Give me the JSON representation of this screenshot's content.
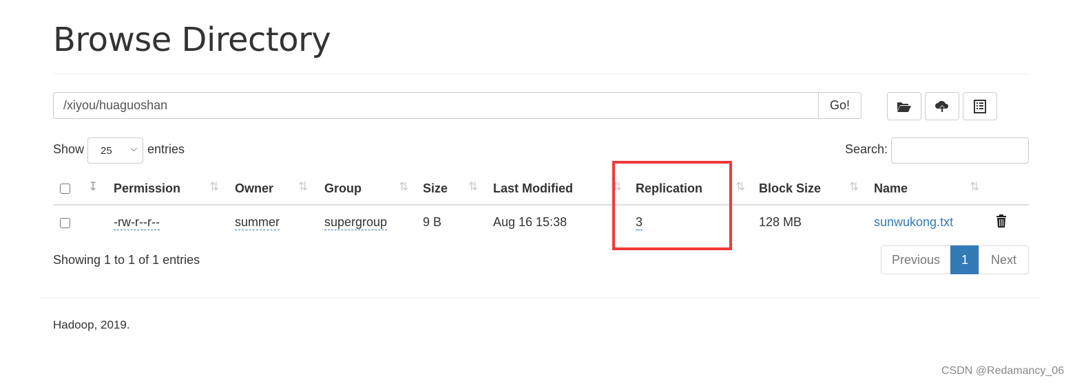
{
  "page": {
    "title": "Browse Directory",
    "footer": "Hadoop, 2019.",
    "watermark": "CSDN @Redamancy_06"
  },
  "toolbar": {
    "path_value": "/xiyou/huaguoshan",
    "go_label": "Go!",
    "icons": [
      "folder-open-icon",
      "cloud-upload-icon",
      "list-icon"
    ]
  },
  "table_controls": {
    "show_label": "Show",
    "entries_value": "25",
    "entries_label": "entries",
    "search_label": "Search:",
    "search_value": ""
  },
  "table": {
    "columns": [
      "Permission",
      "Owner",
      "Group",
      "Size",
      "Last Modified",
      "Replication",
      "Block Size",
      "Name"
    ],
    "rows": [
      {
        "permission": "-rw-r--r--",
        "owner": "summer",
        "group": "supergroup",
        "size": "9 B",
        "last_modified": "Aug 16 15:38",
        "replication": "3",
        "block_size": "128 MB",
        "name": "sunwukong.txt"
      }
    ]
  },
  "pagination": {
    "info": "Showing 1 to 1 of 1 entries",
    "previous": "Previous",
    "current": "1",
    "next": "Next"
  },
  "colors": {
    "link": "#337ab7",
    "highlight_box": "#f03a3a",
    "active_page": "#337ab7"
  }
}
